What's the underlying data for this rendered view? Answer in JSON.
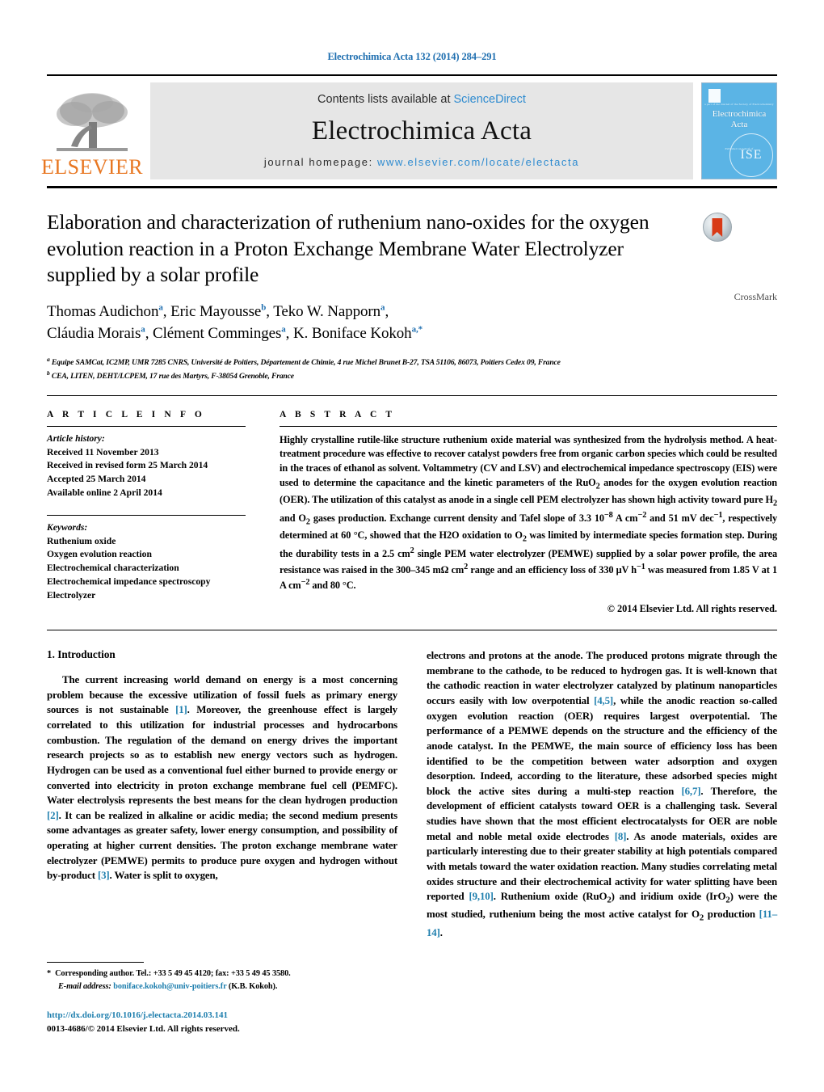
{
  "running_head": "Electrochimica Acta 132 (2014) 284–291",
  "masthead": {
    "elsevier_wordmark": "ELSEVIER",
    "contents_prefix": "Contents lists available at ",
    "contents_link": "ScienceDirect",
    "journal_title": "Electrochimica Acta",
    "homepage_prefix": "journal homepage: ",
    "homepage_url": "www.elsevier.com/locate/electacta",
    "cover": {
      "title_line1": "Electrochimica",
      "title_line2": "Acta",
      "top_micro": "a part of the Journal of the Society of Electrochemistry",
      "bottom_micro": "Published on behalf of",
      "society_mark": "ISE"
    },
    "accent_link_color": "#2e8bd0",
    "elsevier_orange": "#E87722"
  },
  "article": {
    "title": "Elaboration and characterization of ruthenium nano-oxides for the oxygen evolution reaction in a Proton Exchange Membrane Water Electrolyzer supplied by a solar profile",
    "authors_line1_parts": [
      {
        "name": "Thomas Audichon",
        "sup": "a"
      },
      {
        "name": "Eric Mayousse",
        "sup": "b"
      },
      {
        "name": "Teko W. Napporn",
        "sup": "a"
      }
    ],
    "authors_line2_parts": [
      {
        "name": "Cláudia Morais",
        "sup": "a"
      },
      {
        "name": "Clément Comminges",
        "sup": "a"
      },
      {
        "name": "K. Boniface Kokoh",
        "sup": "a,*"
      }
    ],
    "affiliation_a": "Equipe SAMCat, IC2MP, UMR 7285 CNRS, Université de Poitiers, Département de Chimie, 4 rue Michel Brunet B-27, TSA 51106, 86073, Poitiers Cedex 09, France",
    "affiliation_b": "CEA, LITEN, DEHT/LCPEM, 17 rue des Martyrs, F-38054 Grenoble, France",
    "crossmark_label": "CrossMark"
  },
  "article_info": {
    "heading": "A R T I C L E   I N F O",
    "history_label": "Article history:",
    "history_items": [
      "Received 11 November 2013",
      "Received in revised form 25 March 2014",
      "Accepted 25 March 2014",
      "Available online 2 April 2014"
    ],
    "keywords_label": "Keywords:",
    "keywords": [
      "Ruthenium oxide",
      "Oxygen evolution reaction",
      "Electrochemical characterization",
      "Electrochemical impedance spectroscopy",
      "Electrolyzer"
    ]
  },
  "abstract": {
    "heading": "A B S T R A C T",
    "text": "Highly crystalline rutile-like structure ruthenium oxide material was synthesized from the hydrolysis method. A heat-treatment procedure was effective to recover catalyst powders free from organic carbon species which could be resulted in the traces of ethanol as solvent. Voltammetry (CV and LSV) and electrochemical impedance spectroscopy (EIS) were used to determine the capacitance and the kinetic parameters of the RuO2 anodes for the oxygen evolution reaction (OER). The utilization of this catalyst as anode in a single cell PEM electrolyzer has shown high activity toward pure H2 and O2 gases production. Exchange current density and Tafel slope of 3.3 10−8 A cm−2 and 51 mV dec−1, respectively determined at 60 °C, showed that the H2O oxidation to O2 was limited by intermediate species formation step. During the durability tests in a 2.5 cm2 single PEM water electrolyzer (PEMWE) supplied by a solar power profile, the area resistance was raised in the 300–345 mΩ cm2 range and an efficiency loss of 330 μV h−1 was measured from 1.85 V at 1 A cm−2 and 80 °C.",
    "copyright": "© 2014 Elsevier Ltd. All rights reserved."
  },
  "body": {
    "section_heading": "1.  Introduction",
    "left_paragraph": "The current increasing world demand on energy is a most concerning problem because the excessive utilization of fossil fuels as primary energy sources is not sustainable [1]. Moreover, the greenhouse effect is largely correlated to this utilization for industrial processes and hydrocarbons combustion. The regulation of the demand on energy drives the important research projects so as to establish new energy vectors such as hydrogen. Hydrogen can be used as a conventional fuel either burned to provide energy or converted into electricity in proton exchange membrane fuel cell (PEMFC). Water electrolysis represents the best means for the clean hydrogen production [2]. It can be realized in alkaline or acidic media; the second medium presents some advantages as greater safety, lower energy consumption, and possibility of operating at higher current densities. The proton exchange membrane water electrolyzer (PEMWE) permits to produce pure oxygen and hydrogen without by-product [3]. Water is split to oxygen,",
    "right_paragraph": "electrons and protons at the anode. The produced protons migrate through the membrane to the cathode, to be reduced to hydrogen gas. It is well-known that the cathodic reaction in water electrolyzer catalyzed by platinum nanoparticles occurs easily with low overpotential [4,5], while the anodic reaction so-called oxygen evolution reaction (OER) requires largest overpotential. The performance of a PEMWE depends on the structure and the efficiency of the anode catalyst. In the PEMWE, the main source of efficiency loss has been identified to be the competition between water adsorption and oxygen desorption. Indeed, according to the literature, these adsorbed species might block the active sites during a multi-step reaction [6,7]. Therefore, the development of efficient catalysts toward OER is a challenging task. Several studies have shown that the most efficient electrocatalysts for OER are noble metal and noble metal oxide electrodes [8]. As anode materials, oxides are particularly interesting due to their greater stability at high potentials compared with metals toward the water oxidation reaction. Many studies correlating metal oxides structure and their electrochemical activity for water splitting have been reported [9,10]. Ruthenium oxide (RuO2) and iridium oxide (IrO2) were the most studied, ruthenium being the most active catalyst for O2 production [11–14]."
  },
  "footer": {
    "corresponding_star": "*",
    "corresponding_text": "Corresponding author. Tel.: +33 5 49 45 4120; fax: +33 5 49 45 3580.",
    "email_label": "E-mail address:",
    "email_link": "boniface.kokoh@univ-poitiers.fr",
    "email_suffix": "(K.B. Kokoh).",
    "doi": "http://dx.doi.org/10.1016/j.electacta.2014.03.141",
    "issn_line": "0013-4686/© 2014 Elsevier Ltd. All rights reserved."
  }
}
